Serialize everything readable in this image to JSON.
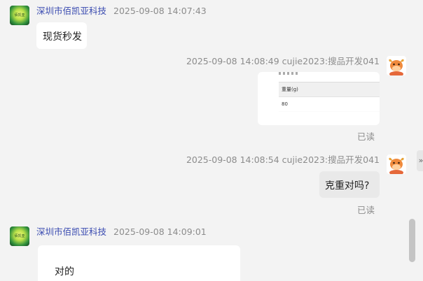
{
  "messages": [
    {
      "sender": "深圳市佰凯亚科技",
      "time": "2025-09-08 14:07:43",
      "text": "现货秒发"
    },
    {
      "meta": "2025-09-08 14:08:49  cujie2023:搜品开发041",
      "card": {
        "header": "重量(g)",
        "value": "80"
      },
      "status": "已读"
    },
    {
      "meta": "2025-09-08 14:08:54  cujie2023:搜品开发041",
      "text": "克重对吗?",
      "status": "已读"
    },
    {
      "sender": "深圳市佰凯亚科技",
      "time": "2025-09-08 14:09:01",
      "text": "对的"
    }
  ],
  "shop_avatar_label": "佰凯亚",
  "side_tab": {
    "glyph": "»"
  }
}
